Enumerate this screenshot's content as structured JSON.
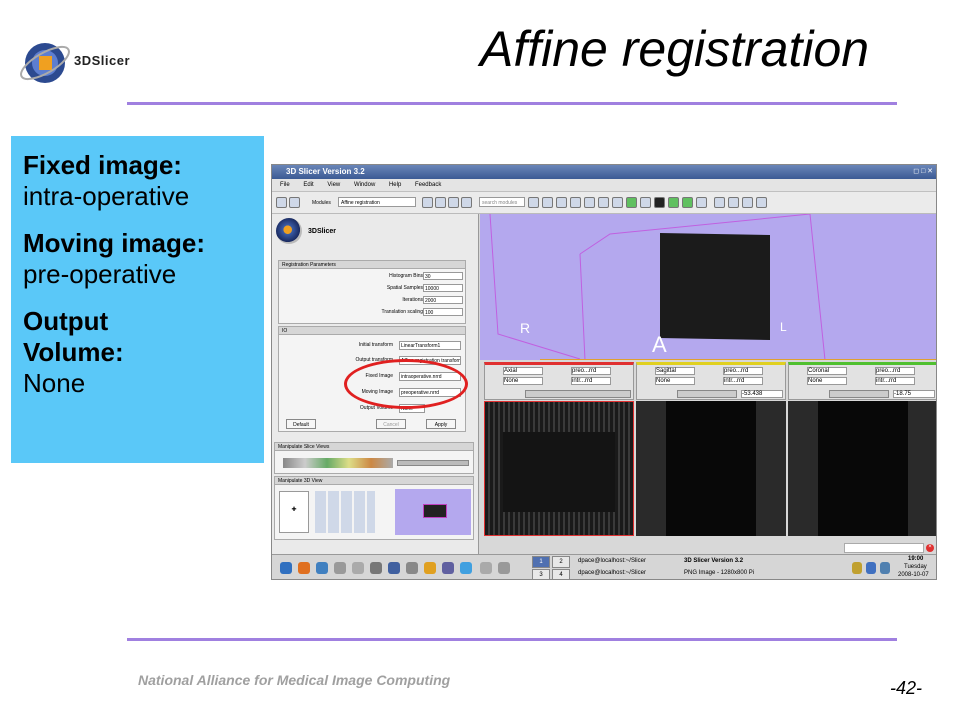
{
  "logo": {
    "text": "3DSlicer"
  },
  "slide": {
    "title": "Affine registration",
    "footer": "National Alliance for Medical Image Computing",
    "page_number": "-42-"
  },
  "notes": [
    {
      "heading": "Fixed image:",
      "value": "intra-operative"
    },
    {
      "heading": "Moving image:",
      "value": "pre-operative"
    },
    {
      "heading": "Output Volume:",
      "value": "None"
    }
  ],
  "colors": {
    "accent_rule": "#a080e0",
    "note_bg": "#5ac8f8",
    "highlight_ring": "#e02020"
  },
  "app": {
    "window_title": "3D Slicer Version 3.2",
    "menu": [
      "File",
      "Edit",
      "View",
      "Window",
      "Help",
      "Feedback"
    ],
    "modules_label": "Modules",
    "module_selected": "Affine registration",
    "search_placeholder": "search modules",
    "panel_logo_text": "3DSlicer",
    "registration": {
      "header": "Registration Parameters",
      "params": [
        {
          "label": "Histogram Bins",
          "value": "30"
        },
        {
          "label": "Spatial Samples",
          "value": "10000"
        },
        {
          "label": "Iterations",
          "value": "2000"
        },
        {
          "label": "Translation scaling",
          "value": "100"
        }
      ]
    },
    "io": {
      "header": "IO",
      "rows": [
        {
          "label": "Initial transform",
          "value": "LinearTransform1"
        },
        {
          "label": "Output transform",
          "value": "Affine registration transform1"
        },
        {
          "label": "Fixed Image",
          "value": "intraoperative.nrrd"
        },
        {
          "label": "Moving Image",
          "value": "preoperative.nrrd"
        },
        {
          "label": "Output Volume",
          "value": "None"
        }
      ]
    },
    "buttons": {
      "default": "Default",
      "cancel": "Cancel",
      "apply": "Apply"
    },
    "manip_slice_header": "Manipulate Slice Views",
    "manip_3d_header": "Manipulate 3D View",
    "view3d_labels": {
      "r": "R",
      "l": "L",
      "a": "A"
    },
    "slices": [
      {
        "orientation": "Axial",
        "fg": "preo...rrd",
        "bg": "intr...rrd",
        "label": "None",
        "offset": "",
        "color": "#e03030"
      },
      {
        "orientation": "Sagittal",
        "fg": "preo...rrd",
        "bg": "intr...rrd",
        "label": "None",
        "offset": "-53.438",
        "color": "#e0d020"
      },
      {
        "orientation": "Coronal",
        "fg": "preo...rrd",
        "bg": "intr...rrd",
        "label": "None",
        "offset": "-18.75",
        "color": "#50c030"
      }
    ],
    "taskbar": {
      "workspaces": [
        "1",
        "2",
        "3",
        "4"
      ],
      "items": [
        "dpace@localhost:~/Slicer",
        "3D Slicer Version 3.2",
        "dpace@localhost:~/Slicer",
        "PNG Image - 1280x800 Pi"
      ],
      "clock": {
        "time": "19:00",
        "day": "Tuesday",
        "date": "2008-10-07"
      }
    }
  }
}
